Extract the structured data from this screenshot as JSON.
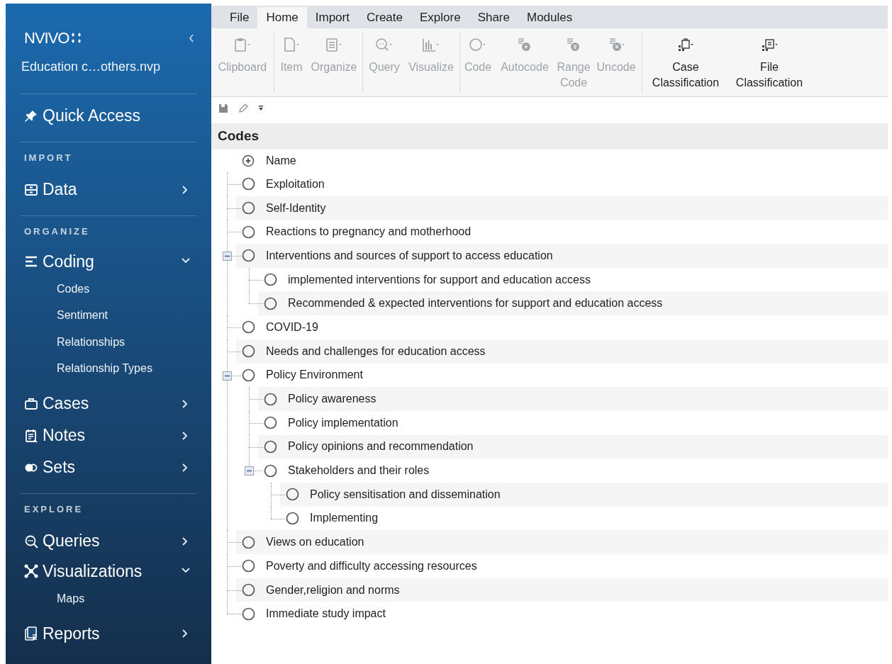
{
  "sidebar": {
    "logo": "NVIVO",
    "project": "Education c…others.nvp",
    "sections": [
      {
        "items": [
          {
            "label": "Quick Access"
          }
        ]
      },
      {
        "header": "IMPORT",
        "items": [
          {
            "label": "Data",
            "expanded": false
          }
        ]
      },
      {
        "header": "ORGANIZE",
        "items": [
          {
            "label": "Coding",
            "expanded": true,
            "children": [
              {
                "label": "Codes"
              },
              {
                "label": "Sentiment"
              },
              {
                "label": "Relationships"
              },
              {
                "label": "Relationship Types"
              }
            ]
          },
          {
            "label": "Cases",
            "expanded": false
          },
          {
            "label": "Notes",
            "expanded": false
          },
          {
            "label": "Sets",
            "expanded": false
          }
        ]
      },
      {
        "header": "EXPLORE",
        "items": [
          {
            "label": "Queries",
            "expanded": false
          },
          {
            "label": "Visualizations",
            "expanded": true,
            "children": [
              {
                "label": "Maps"
              }
            ]
          },
          {
            "label": "Reports",
            "expanded": false
          }
        ]
      }
    ]
  },
  "ribbon": {
    "tabs": [
      {
        "label": "File",
        "selected": false
      },
      {
        "label": "Home",
        "selected": true
      },
      {
        "label": "Import",
        "selected": false
      },
      {
        "label": "Create",
        "selected": false
      },
      {
        "label": "Explore",
        "selected": false
      },
      {
        "label": "Share",
        "selected": false
      },
      {
        "label": "Modules",
        "selected": false
      }
    ],
    "groups": [
      {
        "buttons": [
          {
            "label": "Clipboard",
            "disabled": true
          }
        ]
      },
      {
        "buttons": [
          {
            "label": "Item",
            "disabled": true
          },
          {
            "label": "Organize",
            "disabled": true
          }
        ]
      },
      {
        "buttons": [
          {
            "label": "Query",
            "disabled": true
          },
          {
            "label": "Visualize",
            "disabled": true
          }
        ]
      },
      {
        "buttons": [
          {
            "label": "Code",
            "disabled": true
          },
          {
            "label": "Autocode",
            "disabled": true
          },
          {
            "label": "Range Code",
            "disabled": true
          },
          {
            "label": "Uncode",
            "disabled": true
          }
        ]
      },
      {
        "buttons": [
          {
            "label": "Case Classification",
            "disabled": false
          },
          {
            "label": "File Classification",
            "disabled": false
          }
        ]
      }
    ]
  },
  "codes": {
    "title": "Codes",
    "column": "Name",
    "nodes": [
      {
        "name": "Exploitation"
      },
      {
        "name": "Self-Identity"
      },
      {
        "name": "Reactions to pregnancy and motherhood"
      },
      {
        "name": "Interventions and sources of support to access education",
        "expanded": true,
        "children": [
          {
            "name": "implemented interventions for support and education access"
          },
          {
            "name": "Recommended & expected interventions for support and education access"
          }
        ]
      },
      {
        "name": "COVID-19"
      },
      {
        "name": "Needs and challenges for education access"
      },
      {
        "name": "Policy Environment",
        "expanded": true,
        "children": [
          {
            "name": "Policy awareness"
          },
          {
            "name": "Policy implementation"
          },
          {
            "name": "Policy opinions and recommendation"
          },
          {
            "name": "Stakeholders and their roles",
            "expanded": true,
            "children": [
              {
                "name": "Policy sensitisation and dissemination"
              },
              {
                "name": "Implementing"
              }
            ]
          }
        ]
      },
      {
        "name": "Views on education"
      },
      {
        "name": "Poverty and difficulty accessing resources"
      },
      {
        "name": "Gender,religion and norms"
      },
      {
        "name": "Immediate study impact"
      }
    ]
  }
}
